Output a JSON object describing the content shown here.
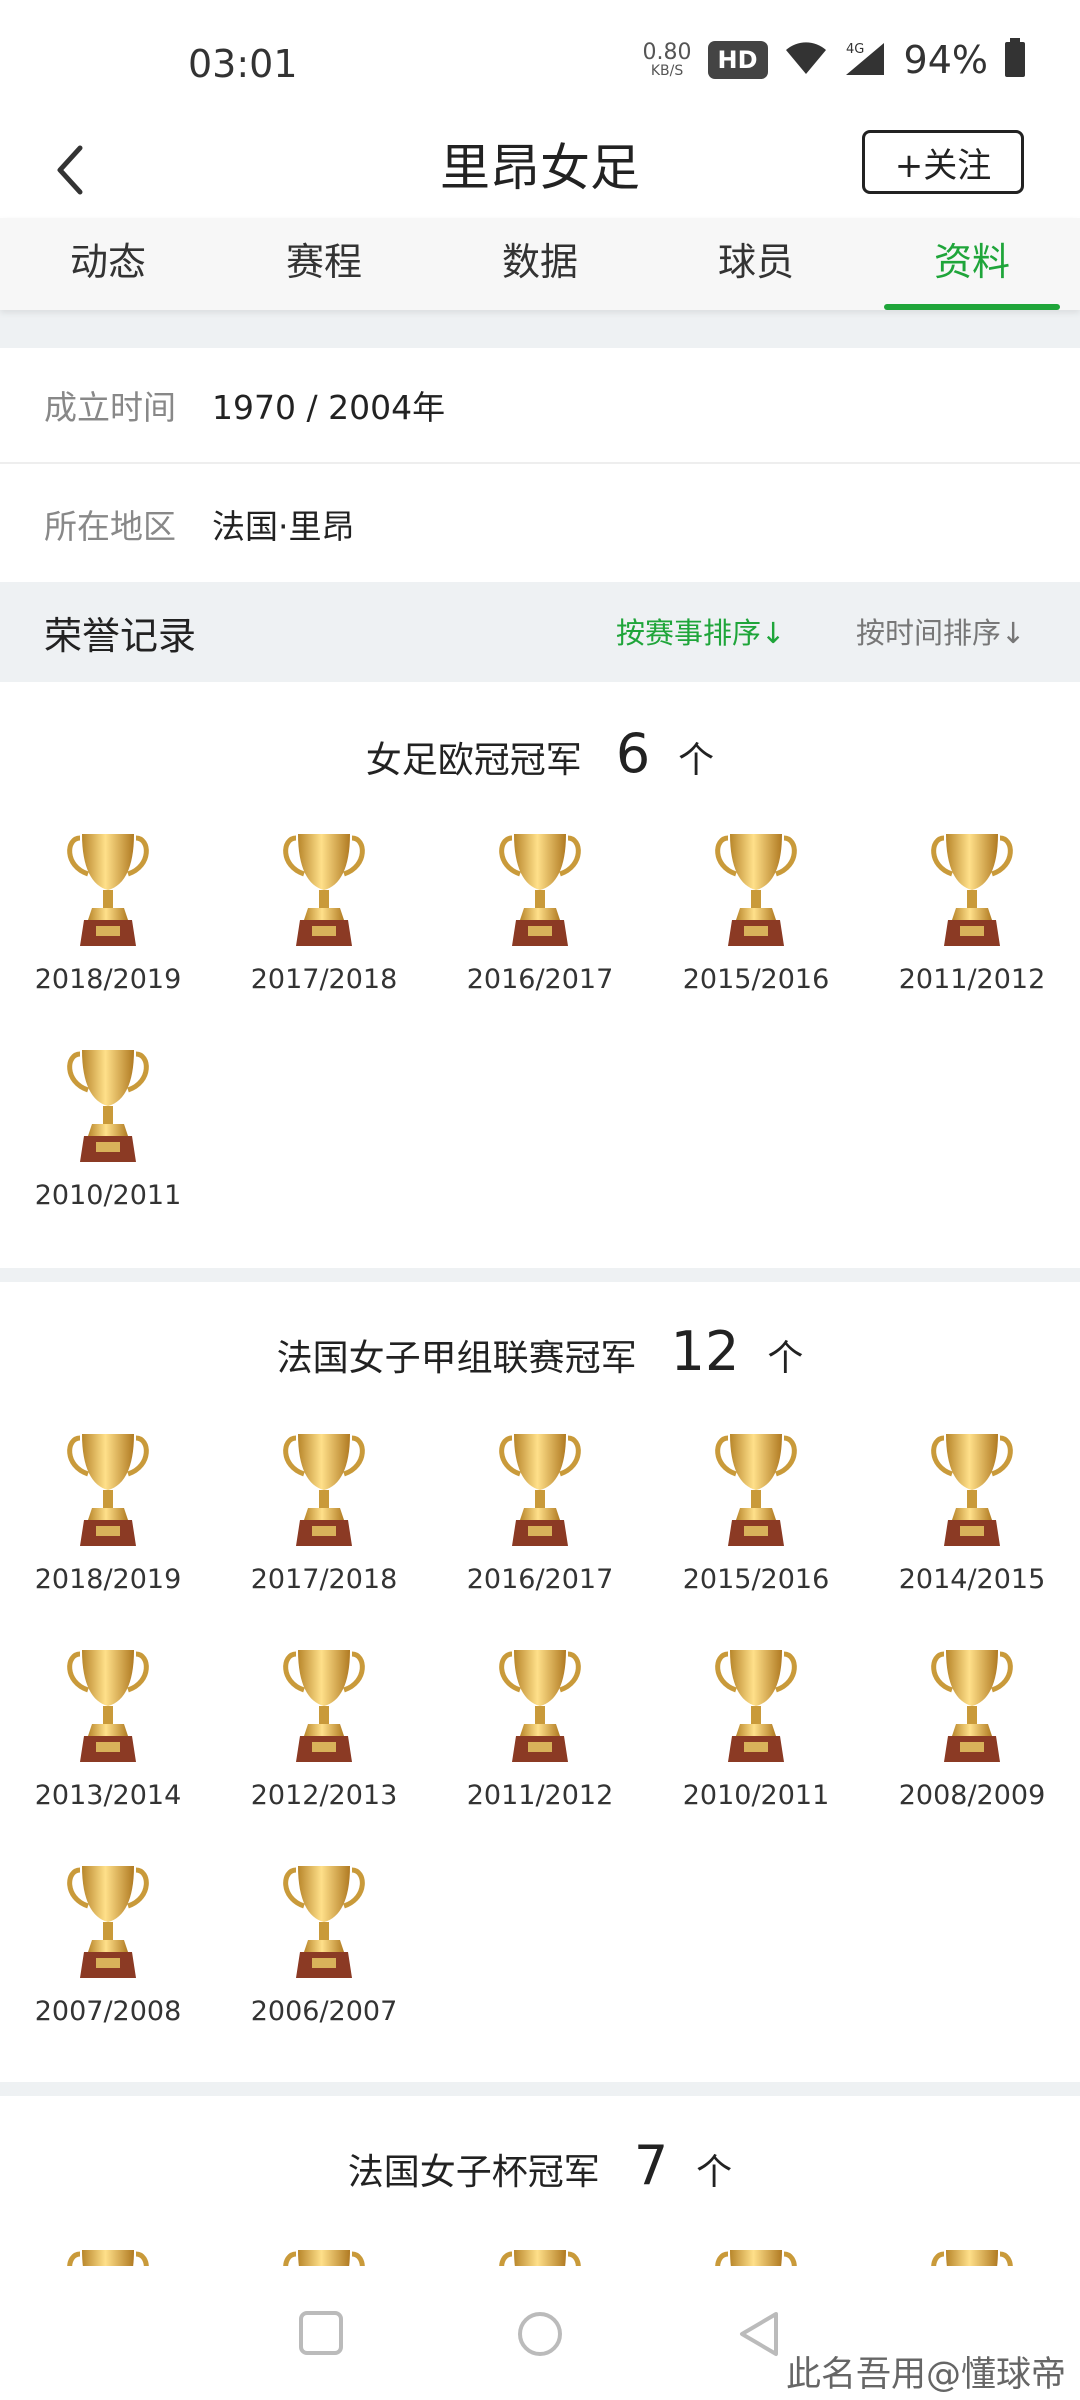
{
  "status": {
    "time": "03:01",
    "net_speed": "0.80",
    "net_unit": "KB/S",
    "hd": "HD",
    "battery": "94%"
  },
  "nav": {
    "title": "里昂女足",
    "follow": "+关注"
  },
  "tabs": [
    "动态",
    "赛程",
    "数据",
    "球员",
    "资料"
  ],
  "active_tab": "资料",
  "basic_info": {
    "founded_label": "成立时间",
    "founded_value": "1970 / 2004年",
    "region_label": "所在地区",
    "region_value": "法国·里昂"
  },
  "honors": {
    "title": "荣誉记录",
    "sort_by_competition": "按赛事排序↓",
    "sort_by_time": "按时间排序↓",
    "competitions": [
      {
        "name": "女足欧冠冠军",
        "count": "6",
        "unit": "个",
        "seasons": [
          "2018/2019",
          "2017/2018",
          "2016/2017",
          "2015/2016",
          "2011/2012",
          "2010/2011"
        ]
      },
      {
        "name": "法国女子甲组联赛冠军",
        "count": "12",
        "unit": "个",
        "seasons": [
          "2018/2019",
          "2017/2018",
          "2016/2017",
          "2015/2016",
          "2014/2015",
          "2013/2014",
          "2012/2013",
          "2011/2012",
          "2010/2011",
          "2008/2009",
          "2007/2008",
          "2006/2007"
        ]
      },
      {
        "name": "法国女子杯冠军",
        "count": "7",
        "unit": "个",
        "seasons": []
      }
    ]
  },
  "watermark": "此名吾用@懂球帝",
  "colors": {
    "accent": "#1fa53a",
    "section_bg": "#eef1f3"
  },
  "icons": {
    "back": "chevron-left-icon",
    "trophy": "gold-trophy-icon",
    "wifi": "wifi-icon",
    "signal": "signal-4g-icon",
    "battery": "battery-icon"
  }
}
